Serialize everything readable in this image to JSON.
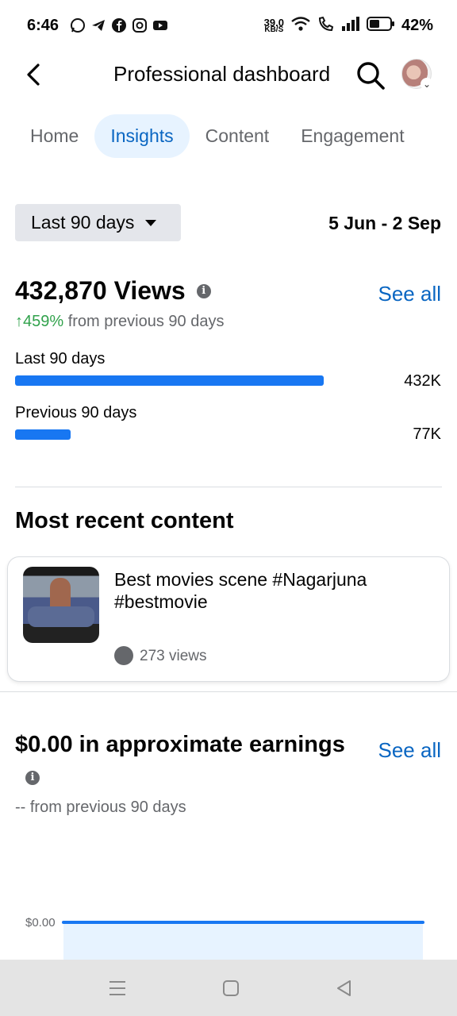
{
  "status_bar": {
    "time": "6:46",
    "net_speed_value": "39.0",
    "net_speed_unit": "KB/S",
    "battery": "42%"
  },
  "header": {
    "title": "Professional dashboard"
  },
  "tabs": [
    {
      "label": "Home",
      "active": false
    },
    {
      "label": "Insights",
      "active": true
    },
    {
      "label": "Content",
      "active": false
    },
    {
      "label": "Engagement",
      "active": false
    }
  ],
  "filter": {
    "selected_period": "Last 90 days",
    "date_range": "5 Jun - 2 Sep"
  },
  "views": {
    "title": "432,870 Views",
    "see_all": "See all",
    "change_pct": "↑459%",
    "change_text": " from previous 90 days",
    "current_label": "Last 90 days",
    "current_value": "432K",
    "current_fraction": 0.81,
    "previous_label": "Previous 90 days",
    "previous_value": "77K",
    "previous_fraction": 0.145
  },
  "recent_content": {
    "section_title": "Most recent content",
    "title": "Best movies scene #Nagarjuna #bestmovie",
    "views": "273 views"
  },
  "earnings": {
    "title": "$0.00 in approximate earnings",
    "see_all": "See all",
    "change_text": "-- from previous 90 days",
    "chart_y_label": "$0.00"
  },
  "colors": {
    "accent": "#1877f2",
    "link": "#0a66c2",
    "positive": "#31a24c"
  }
}
